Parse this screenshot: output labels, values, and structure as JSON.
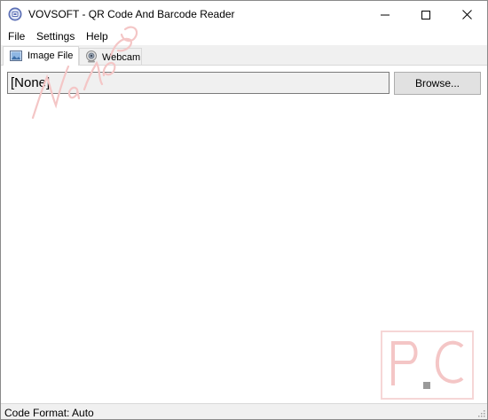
{
  "window": {
    "title": "VOVSOFT - QR Code And Barcode Reader"
  },
  "menu": {
    "items": [
      {
        "label": "File"
      },
      {
        "label": "Settings"
      },
      {
        "label": "Help"
      }
    ]
  },
  "tabs": [
    {
      "label": "Image File",
      "icon": "image-icon",
      "selected": true
    },
    {
      "label": "Webcam",
      "icon": "webcam-icon",
      "selected": false
    }
  ],
  "image_file": {
    "path_value": "[None]",
    "browse_label": "Browse..."
  },
  "status": {
    "text": "Code Format: Auto"
  },
  "colors": {
    "watermark": "#f4c6c6",
    "accent": "#4a7fc0"
  }
}
